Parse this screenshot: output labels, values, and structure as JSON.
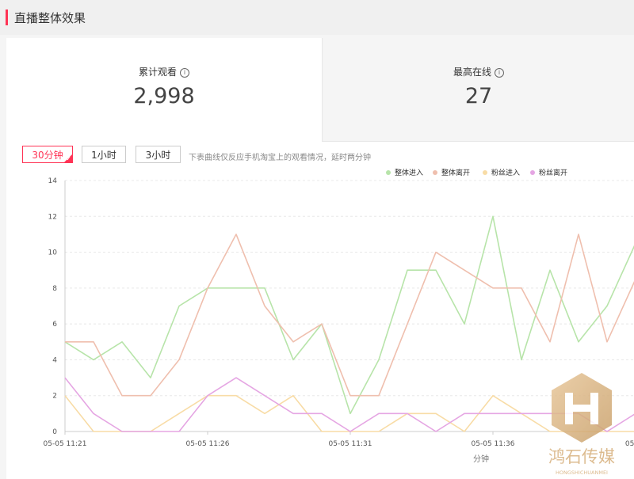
{
  "header": {
    "title": "直播整体效果"
  },
  "stats": [
    {
      "label": "累计观看",
      "value": "2,998"
    },
    {
      "label": "最高在线",
      "value": "27"
    }
  ],
  "tabs": [
    {
      "label": "30分钟",
      "active": true
    },
    {
      "label": "1小时",
      "active": false
    },
    {
      "label": "3小时",
      "active": false
    }
  ],
  "note": "下表曲线仅反应手机淘宝上的观看情况，延时两分钟",
  "info_icon": "i",
  "watermark": {
    "text": "鸿石传媒",
    "subtext": "HONGSHICHUANMEI"
  },
  "chart_data": {
    "type": "line",
    "xlabel": "分钟",
    "ylabel": "",
    "ylim": [
      0,
      14
    ],
    "yticks": [
      0,
      2,
      4,
      6,
      8,
      10,
      12,
      14
    ],
    "xtick_labels": [
      "05-05 11:21",
      "05-05 11:26",
      "05-05 11:31",
      "05-05 11:36",
      "05-05"
    ],
    "x": [
      "11:21",
      "11:22",
      "11:23",
      "11:24",
      "11:25",
      "11:26",
      "11:27",
      "11:28",
      "11:29",
      "11:30",
      "11:31",
      "11:32",
      "11:33",
      "11:34",
      "11:35",
      "11:36",
      "11:37",
      "11:38",
      "11:39",
      "11:40",
      "11:41"
    ],
    "legend_position": "top-right",
    "series": [
      {
        "name": "整体进入",
        "color": "#b7e4a9",
        "values": [
          5,
          4,
          5,
          3,
          7,
          8,
          8,
          8,
          4,
          6,
          1,
          4,
          9,
          9,
          6,
          12,
          4,
          9,
          5,
          7,
          10.5
        ]
      },
      {
        "name": "整体离开",
        "color": "#efbfae",
        "values": [
          5,
          5,
          2,
          2,
          4,
          8,
          11,
          7,
          5,
          6,
          2,
          2,
          6,
          10,
          9,
          8,
          8,
          5,
          11,
          5,
          8.5
        ]
      },
      {
        "name": "粉丝进入",
        "color": "#f8dca6",
        "values": [
          2,
          0,
          0,
          0,
          1,
          2,
          2,
          1,
          2,
          0,
          0,
          0,
          1,
          1,
          0,
          2,
          1,
          0,
          0,
          0,
          0
        ]
      },
      {
        "name": "粉丝离开",
        "color": "#e5a6e3",
        "values": [
          3,
          1,
          0,
          0,
          0,
          2,
          3,
          2,
          1,
          1,
          0,
          1,
          1,
          0,
          1,
          1,
          1,
          1,
          1,
          0,
          1
        ]
      }
    ]
  }
}
